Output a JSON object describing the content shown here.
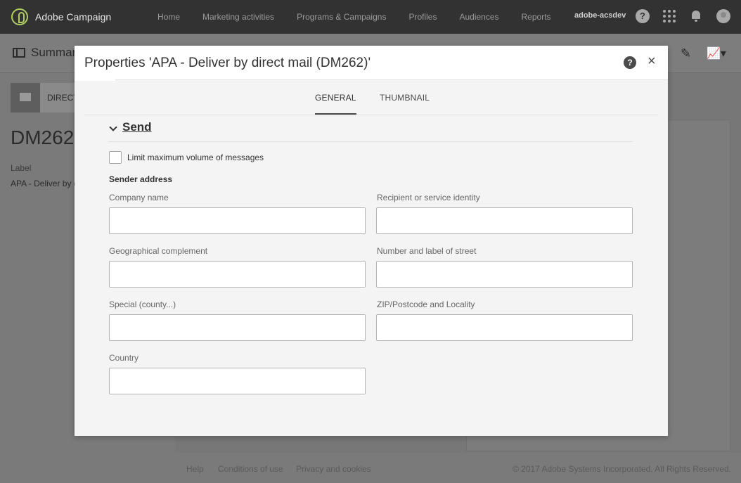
{
  "app": {
    "brand_name": "Adobe Campaign",
    "nav": [
      "Home",
      "Marketing activities",
      "Programs & Campaigns",
      "Profiles",
      "Audiences",
      "Reports"
    ],
    "user": "adobe-acsdev",
    "help_glyph": "?"
  },
  "page": {
    "summary_title": "Summar",
    "card_label": "DIRECT",
    "code": "DM262",
    "label_key": "Label",
    "label_value": "APA - Deliver by d"
  },
  "footer": {
    "help": "Help",
    "conditions": "Conditions of use",
    "privacy": "Privacy and cookies",
    "copyright": "© 2017 Adobe Systems Incorporated. All Rights Reserved."
  },
  "modal": {
    "title": "Properties 'APA - Deliver by direct mail (DM262)'",
    "help_glyph": "?",
    "close_glyph": "×",
    "tabs": [
      "GENERAL",
      "THUMBNAIL"
    ],
    "section_title": "Send",
    "limit_label": "Limit maximum volume of messages",
    "sender_title": "Sender address",
    "fields": {
      "company": {
        "label": "Company name",
        "value": ""
      },
      "recipient": {
        "label": "Recipient or service identity",
        "value": ""
      },
      "geo": {
        "label": "Geographical complement",
        "value": ""
      },
      "street": {
        "label": "Number and label of street",
        "value": ""
      },
      "special": {
        "label": "Special (county...)",
        "value": ""
      },
      "zip": {
        "label": "ZIP/Postcode and Locality",
        "value": ""
      },
      "country": {
        "label": "Country",
        "value": ""
      }
    }
  },
  "colors": {
    "topbar": "#323232",
    "brand_accent": "#b2cd62",
    "modal_bg": "#f4f4f4"
  }
}
